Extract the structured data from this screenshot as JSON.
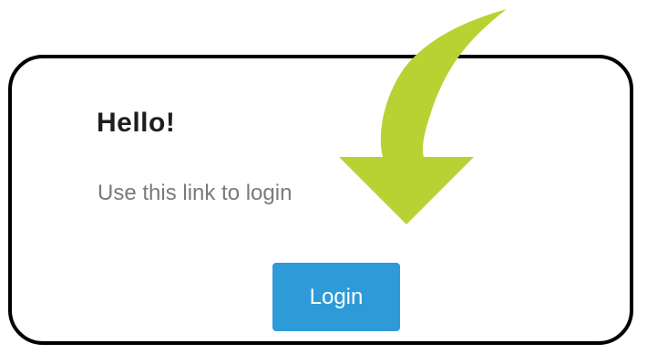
{
  "email": {
    "greeting": "Hello!",
    "message": "Use this link to login",
    "login_button": "Login"
  },
  "colors": {
    "card_border": "#000000",
    "button": "#2e9ad8",
    "arrow": "#b8d233",
    "message_text": "#7a7a7a"
  },
  "icons": {
    "arrow": "curved-down-arrow-icon"
  }
}
